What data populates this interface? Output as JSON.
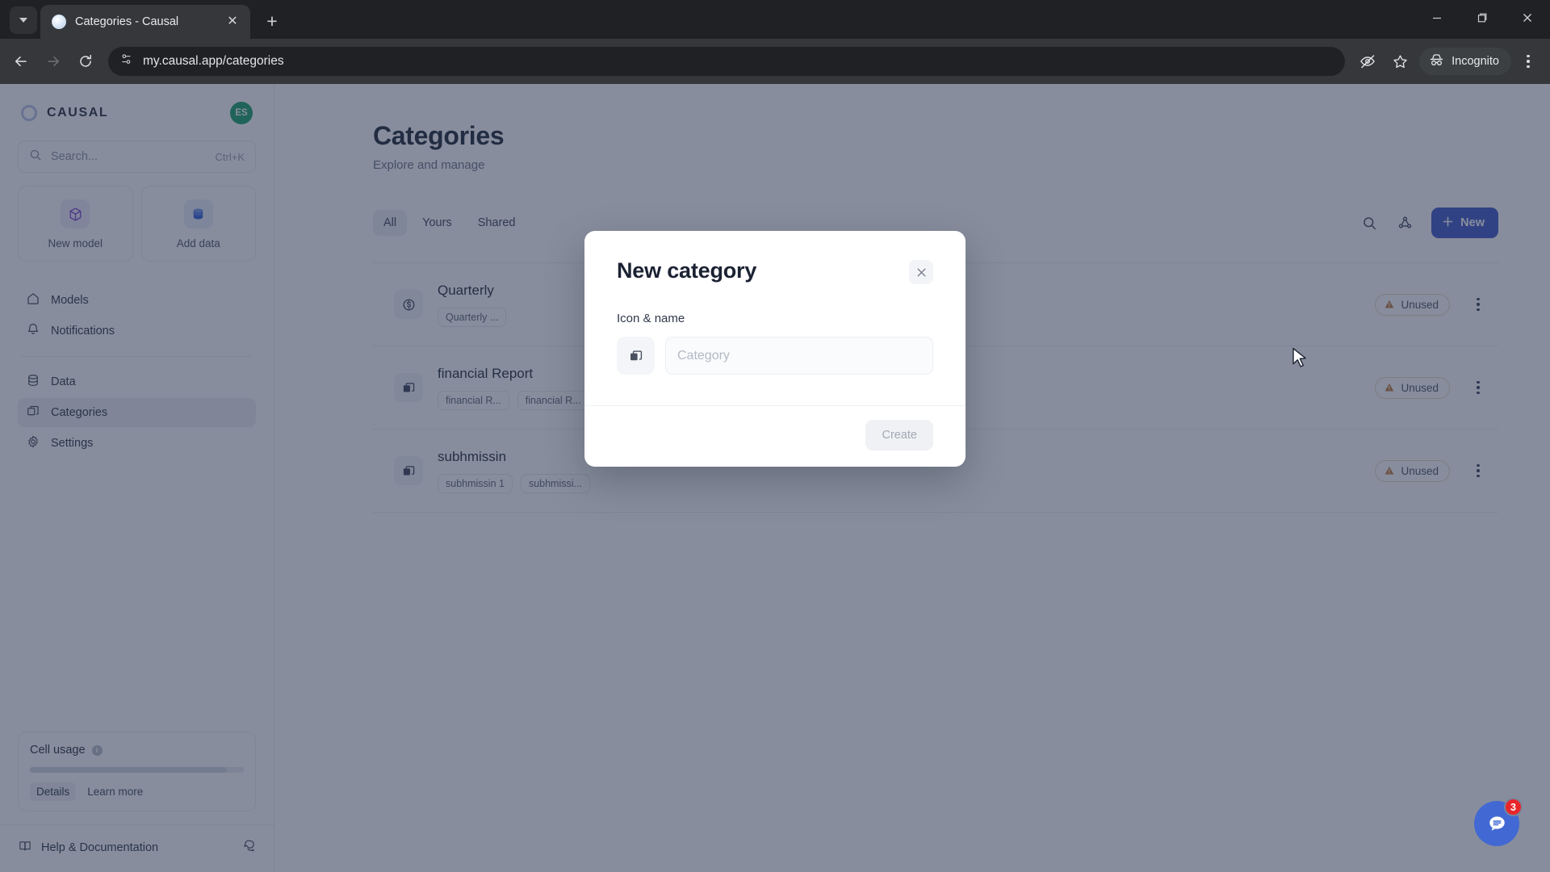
{
  "browser": {
    "tab": {
      "title": "Categories - Causal",
      "favicon_icon": "causal-favicon",
      "close_icon": "close-icon"
    },
    "tab_list_icon": "chevron-down-icon",
    "new_tab_icon": "plus-icon",
    "window_controls": {
      "minimize_icon": "minimize-icon",
      "maximize_icon": "maximize-icon",
      "close_icon": "window-close-icon"
    },
    "nav": {
      "back_icon": "back-arrow-icon",
      "forward_icon": "forward-arrow-icon",
      "reload_icon": "reload-icon"
    },
    "omnibox": {
      "url": "my.causal.app/categories",
      "site_settings_icon": "site-settings-icon"
    },
    "actions": {
      "tracking_protection_icon": "eye-off-icon",
      "bookmark_icon": "star-icon",
      "profile_label": "Incognito",
      "profile_icon": "incognito-icon",
      "menu_icon": "three-dot-menu-icon"
    }
  },
  "sidebar": {
    "brand": {
      "name": "CAUSAL",
      "logo_icon": "causal-logo-icon"
    },
    "avatar": {
      "initials": "ES"
    },
    "search": {
      "placeholder": "Search...",
      "shortcut": "Ctrl+K",
      "icon": "search-icon"
    },
    "quick_actions": [
      {
        "label": "New model",
        "icon": "cube-icon"
      },
      {
        "label": "Add data",
        "icon": "database-icon"
      }
    ],
    "nav_primary": [
      {
        "label": "Models",
        "icon": "home-icon",
        "active": false
      },
      {
        "label": "Notifications",
        "icon": "bell-icon",
        "active": false
      }
    ],
    "nav_secondary": [
      {
        "label": "Data",
        "icon": "database-icon",
        "active": false
      },
      {
        "label": "Categories",
        "icon": "categories-icon",
        "active": true
      },
      {
        "label": "Settings",
        "icon": "gear-icon",
        "active": false
      }
    ],
    "usage": {
      "title": "Cell usage",
      "info_icon": "info-icon",
      "progress_percent": 92,
      "details_label": "Details",
      "learn_more_label": "Learn more"
    },
    "footer": {
      "label": "Help & Documentation",
      "book_icon": "book-icon",
      "chat_icon": "chat-bubbles-icon"
    }
  },
  "main": {
    "title": "Categories",
    "subtitle": "Explore and manage",
    "tabs": [
      {
        "label": "All",
        "active": true
      },
      {
        "label": "Yours",
        "active": false
      },
      {
        "label": "Shared",
        "active": false
      }
    ],
    "actions": {
      "search_icon": "search-icon",
      "filter_icon": "node-graph-icon",
      "new_label": "New",
      "new_plus_icon": "plus-icon"
    },
    "rows": [
      {
        "title": "Quarterly",
        "icon": "dollar-circle-icon",
        "chips": [
          "Quarterly ..."
        ],
        "status": "Unused",
        "status_icon": "warning-triangle-icon",
        "menu_icon": "three-dot-menu-icon"
      },
      {
        "title": "financial Report",
        "icon": "categories-icon",
        "chips": [
          "financial R...",
          "financial R..."
        ],
        "status": "Unused",
        "status_icon": "warning-triangle-icon",
        "menu_icon": "three-dot-menu-icon"
      },
      {
        "title": "subhmissin",
        "icon": "categories-icon",
        "chips": [
          "subhmissin 1",
          "subhmissi..."
        ],
        "status": "Unused",
        "status_icon": "warning-triangle-icon",
        "menu_icon": "three-dot-menu-icon"
      }
    ],
    "chat_widget": {
      "count": "3",
      "icon": "chat-bubble-icon"
    }
  },
  "modal": {
    "title": "New category",
    "close_icon": "close-icon",
    "field_label": "Icon & name",
    "icon_picker_icon": "categories-icon",
    "name_value": "",
    "name_placeholder": "Category",
    "create_label": "Create"
  },
  "colors": {
    "accent": "#3c55c8",
    "avatar": "#16a06a",
    "chat_fab": "#4268d3",
    "badge_count": "#e8262a",
    "overlay": "#7c8499"
  }
}
